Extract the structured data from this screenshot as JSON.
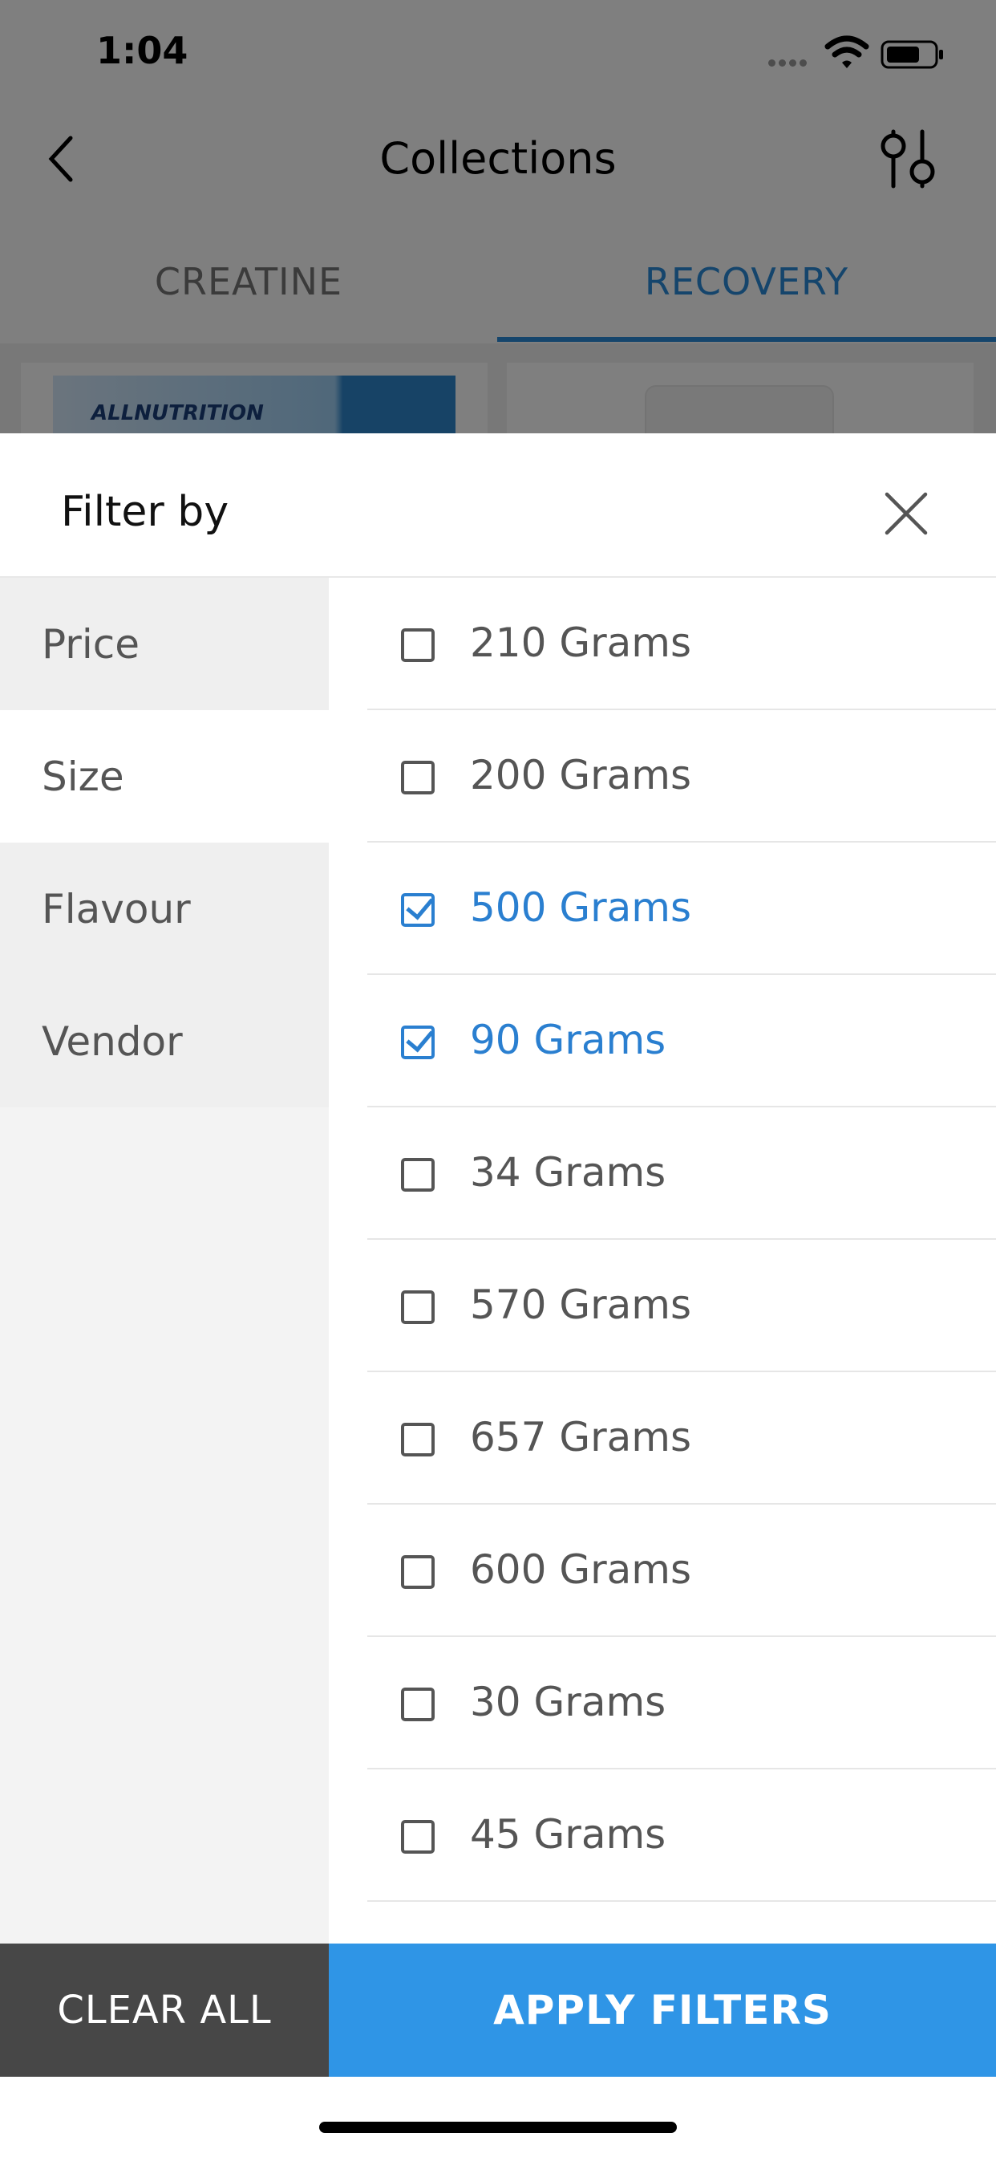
{
  "status_bar": {
    "time": "1:04"
  },
  "navbar": {
    "title": "Collections"
  },
  "tabs": [
    {
      "label": "CREATINE",
      "active": false
    },
    {
      "label": "RECOVERY",
      "active": true
    }
  ],
  "background_product": {
    "brand_text": "ALLNUTRITION"
  },
  "sheet": {
    "title": "Filter by",
    "categories": [
      {
        "label": "Price"
      },
      {
        "label": "Size",
        "active": true
      },
      {
        "label": "Flavour"
      },
      {
        "label": "Vendor"
      }
    ],
    "options": [
      {
        "label": "210 Grams",
        "checked": false
      },
      {
        "label": "200 Grams",
        "checked": false
      },
      {
        "label": "500 Grams",
        "checked": true
      },
      {
        "label": "90 Grams",
        "checked": true
      },
      {
        "label": "34 Grams",
        "checked": false
      },
      {
        "label": "570 Grams",
        "checked": false
      },
      {
        "label": "657 Grams",
        "checked": false
      },
      {
        "label": "600 Grams",
        "checked": false
      },
      {
        "label": "30 Grams",
        "checked": false
      },
      {
        "label": "45 Grams",
        "checked": false
      }
    ],
    "clear_label": "CLEAR ALL",
    "apply_label": "APPLY FILTERS"
  },
  "colors": {
    "accent": "#2f95e6",
    "checked_text": "#2a7fd0",
    "clear_button": "#474747"
  }
}
